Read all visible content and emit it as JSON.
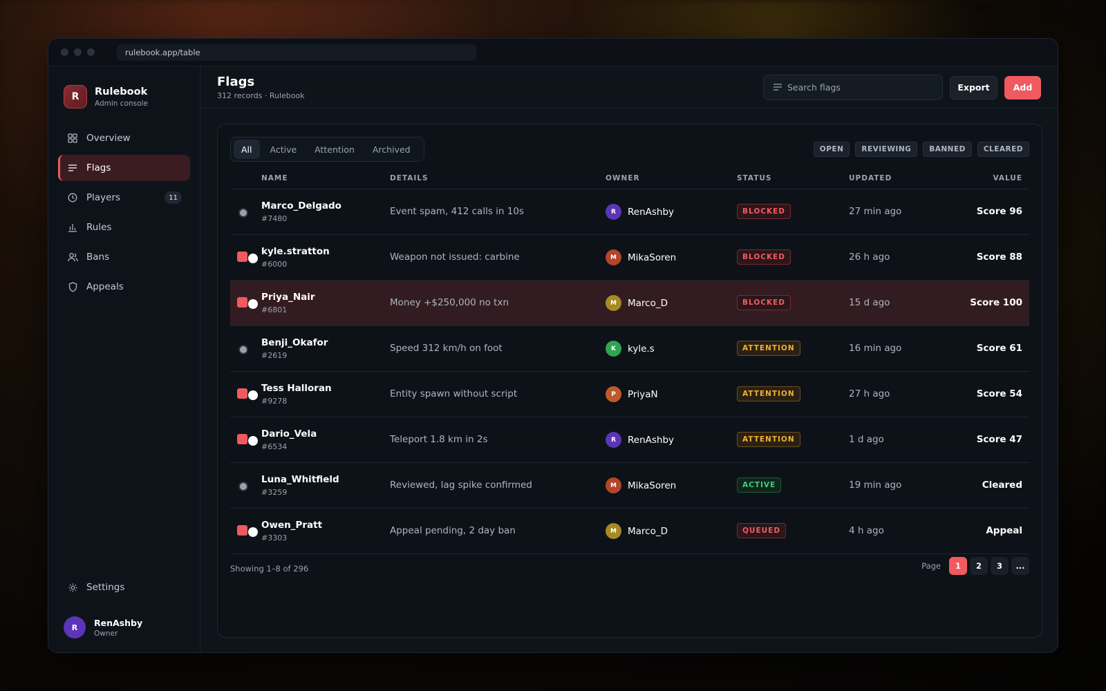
{
  "browser": {
    "url": "rulebook.app/table"
  },
  "brand": {
    "logo_letter": "R",
    "name": "Rulebook",
    "subtitle": "Admin console"
  },
  "sidebar": {
    "items": [
      {
        "label": "Overview",
        "icon": "grid-icon",
        "active": false
      },
      {
        "label": "Flags",
        "icon": "list-icon",
        "active": true
      },
      {
        "label": "Players",
        "icon": "clock-icon",
        "badge": "11",
        "active": false
      },
      {
        "label": "Rules",
        "icon": "bar-chart-icon",
        "active": false
      },
      {
        "label": "Bans",
        "icon": "users-icon",
        "active": false
      },
      {
        "label": "Appeals",
        "icon": "shield-icon",
        "active": false
      }
    ],
    "settings_label": "Settings"
  },
  "user": {
    "initial": "R",
    "name": "RenAshby",
    "role": "Owner"
  },
  "header": {
    "title": "Flags",
    "subtitle": "312 records · Rulebook",
    "search_placeholder": "Search flags",
    "export_label": "Export",
    "add_label": "Add"
  },
  "tabs": [
    {
      "label": "All",
      "active": true
    },
    {
      "label": "Active",
      "active": false
    },
    {
      "label": "Attention",
      "active": false
    },
    {
      "label": "Archived",
      "active": false
    }
  ],
  "filter_chips": [
    "OPEN",
    "REVIEWING",
    "BANNED",
    "CLEARED"
  ],
  "table": {
    "columns": [
      "NAME",
      "DETAILS",
      "OWNER",
      "STATUS",
      "UPDATED",
      "VALUE"
    ],
    "rows": [
      {
        "selection": "dot",
        "name": "Marco_Delgado",
        "id": "#7480",
        "details": "Event spam, 412 calls in 10s",
        "owner_initial": "R",
        "owner": "RenAshby",
        "owner_color": "#5b35b8",
        "status": "BLOCKED",
        "updated": "27 min ago",
        "value": "Score 96",
        "highlight": false
      },
      {
        "selection": "toggle",
        "name": "kyle.stratton",
        "id": "#6000",
        "details": "Weapon not issued: carbine",
        "owner_initial": "M",
        "owner": "MikaSoren",
        "owner_color": "#b2452c",
        "status": "BLOCKED",
        "updated": "26 h ago",
        "value": "Score 88",
        "highlight": false
      },
      {
        "selection": "toggle",
        "name": "Priya_Nair",
        "id": "#6801",
        "details": "Money +$250,000 no txn",
        "owner_initial": "M",
        "owner": "Marco_D",
        "owner_color": "#a68a24",
        "status": "BLOCKED",
        "updated": "15 d ago",
        "value": "Score 100",
        "highlight": true
      },
      {
        "selection": "dot",
        "name": "Benji_Okafor",
        "id": "#2619",
        "details": "Speed 312 km/h on foot",
        "owner_initial": "K",
        "owner": "kyle.s",
        "owner_color": "#2ea552",
        "status": "ATTENTION",
        "updated": "16 min ago",
        "value": "Score 61",
        "highlight": false
      },
      {
        "selection": "toggle",
        "name": "Tess Halloran",
        "id": "#9278",
        "details": "Entity spawn without script",
        "owner_initial": "P",
        "owner": "PriyaN",
        "owner_color": "#c05a2c",
        "status": "ATTENTION",
        "updated": "27 h ago",
        "value": "Score 54",
        "highlight": false
      },
      {
        "selection": "toggle",
        "name": "Dario_Vela",
        "id": "#6534",
        "details": "Teleport 1.8 km in 2s",
        "owner_initial": "R",
        "owner": "RenAshby",
        "owner_color": "#5b35b8",
        "status": "ATTENTION",
        "updated": "1 d ago",
        "value": "Score 47",
        "highlight": false
      },
      {
        "selection": "dot",
        "name": "Luna_Whitfield",
        "id": "#3259",
        "details": "Reviewed, lag spike confirmed",
        "owner_initial": "M",
        "owner": "MikaSoren",
        "owner_color": "#b2452c",
        "status": "ACTIVE",
        "updated": "19 min ago",
        "value": "Cleared",
        "highlight": false
      },
      {
        "selection": "toggle",
        "name": "Owen_Pratt",
        "id": "#3303",
        "details": "Appeal pending, 2 day ban",
        "owner_initial": "M",
        "owner": "Marco_D",
        "owner_color": "#a68a24",
        "status": "QUEUED",
        "updated": "4 h ago",
        "value": "Appeal",
        "highlight": false
      }
    ]
  },
  "footer": {
    "showing": "Showing 1–8 of 296"
  },
  "pagination": {
    "label": "Page",
    "pages": [
      "1",
      "2",
      "3",
      "..."
    ],
    "current": "1"
  }
}
